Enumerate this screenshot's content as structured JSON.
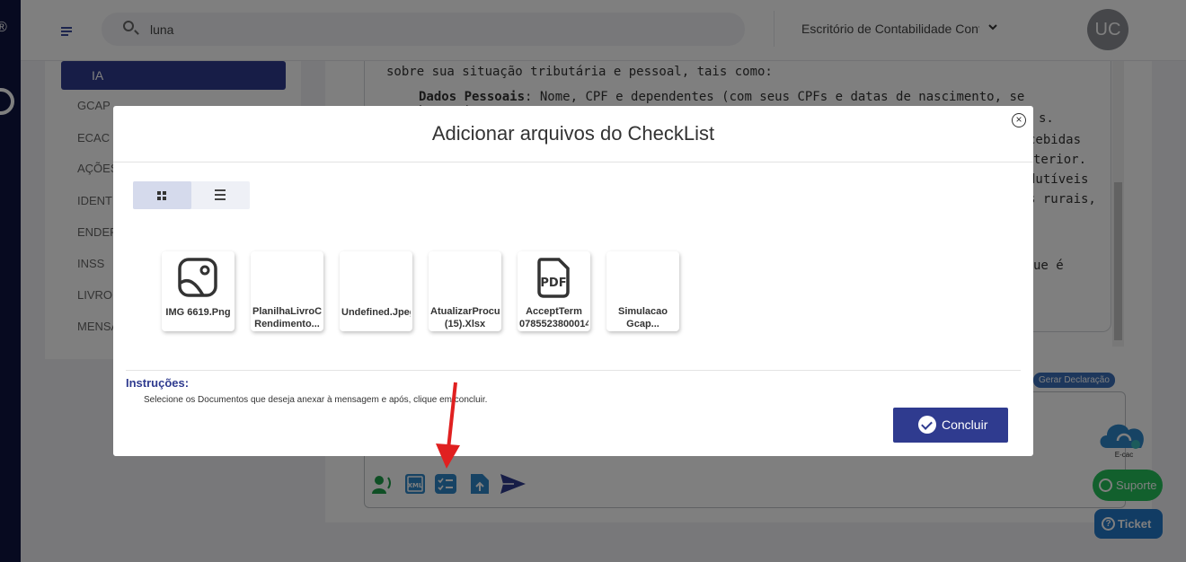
{
  "search": {
    "value": "luna"
  },
  "header": {
    "office": "Escritório de Contabilidade Contábil",
    "avatar_initials": "UC"
  },
  "sidebar": {
    "items": [
      {
        "label": "IA",
        "icon": "ai-icon",
        "active": true
      },
      {
        "label": "GCAP",
        "icon": "gcap-icon"
      },
      {
        "label": "ECAC",
        "icon": "ecac-icon"
      },
      {
        "label": "AÇÕES",
        "icon": "actions-icon"
      },
      {
        "label": "IDENTIFICAÇÃO",
        "icon": "id-icon"
      },
      {
        "label": "ENDEREÇO",
        "icon": "location-icon"
      },
      {
        "label": "INSS",
        "icon": "globe-icon"
      },
      {
        "label": "LIVRO",
        "icon": "book-icon"
      },
      {
        "label": "MENSAGENS",
        "icon": "chat-icon"
      }
    ]
  },
  "background_text": {
    "line1": "sobre sua situação tributária e pessoal, tais como:",
    "bold": "Dados Pessoais",
    "line2": ": Nome, CPF e dependentes (com seus CPFs e datas de nascimento, se houver).",
    "frag1": "s.",
    "frag2": "cebidas",
    "frag3": "terior.",
    "frag4": "dutíveis",
    "frag5": "s rurais,",
    "frag6": "ue é"
  },
  "gerar_label": "Gerar Declaração",
  "ecac_label": "E-cac",
  "suporte_label": "Suporte",
  "ticket_label": "Ticket",
  "modal": {
    "title": "Adicionar arquivos do CheckList",
    "files": [
      {
        "name": "IMG 6619.Png",
        "icon": "image-icon"
      },
      {
        "name": "PlanilhaLivroCaixa Rendimento...",
        "icon": "none"
      },
      {
        "name": "Undefined.Jpeg",
        "icon": "none"
      },
      {
        "name": "AtualizarProcuracao (15).Xlsx",
        "icon": "none"
      },
      {
        "name": "AcceptTerm 07855238000140",
        "icon": "pdf-icon"
      },
      {
        "name": "Simulacao Gcap...",
        "icon": "none"
      }
    ],
    "instructions_title": "Instruções:",
    "instructions_text": "Selecione os Documentos que deseja anexar à mensagem e após, clique em concluir.",
    "confirm_label": "Concluir"
  },
  "colors": {
    "primary": "#2f3b8f",
    "rail": "#0e1540",
    "whatsapp": "#25c15a",
    "ticket": "#2378c9",
    "annotation_arrow": "#e02020"
  }
}
